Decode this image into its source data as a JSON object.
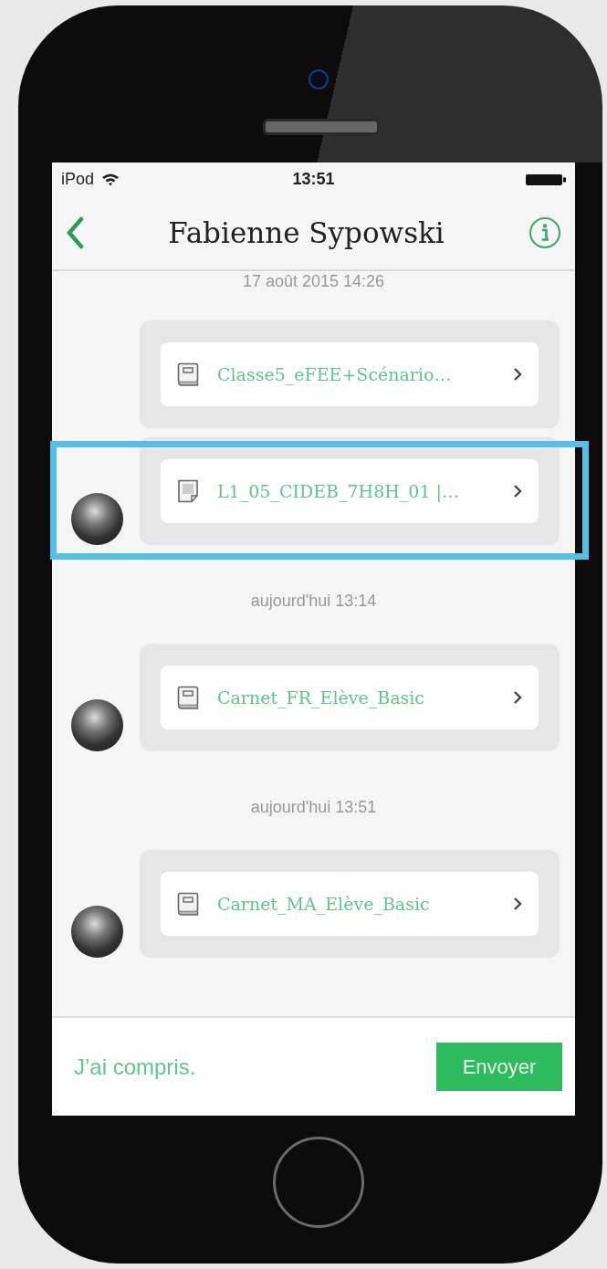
{
  "status_bar": {
    "device": "iPod",
    "time": "13:51"
  },
  "nav": {
    "title": "Fabienne Sypowski"
  },
  "messages": [
    {
      "kind": "timestamp",
      "text": "17 août 2015 14:26"
    },
    {
      "kind": "book_file",
      "name": "Classe5_eFEE+Scénario…",
      "avatar": false,
      "highlighted": false
    },
    {
      "kind": "document_file",
      "name": "L1_05_CIDEB_7H8H_01 |…",
      "avatar": true,
      "highlighted": true
    },
    {
      "kind": "timestamp",
      "text": "aujourd'hui 13:14"
    },
    {
      "kind": "book_file",
      "name": "Carnet_FR_Elève_Basic",
      "avatar": true,
      "highlighted": false
    },
    {
      "kind": "timestamp",
      "text": "aujourd'hui 13:51"
    },
    {
      "kind": "book_file",
      "name": "Carnet_MA_Elève_Basic",
      "avatar": true,
      "highlighted": false
    }
  ],
  "composer": {
    "value": "J’ai compris.",
    "send": "Envoyer"
  }
}
